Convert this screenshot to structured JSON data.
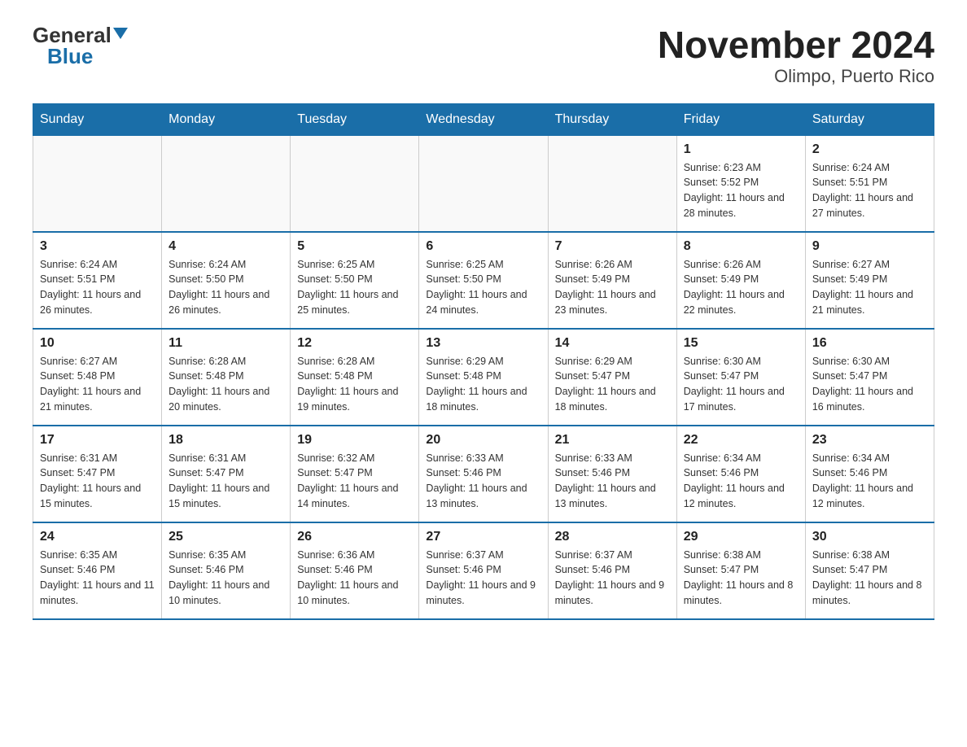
{
  "logo": {
    "general": "General",
    "blue": "Blue"
  },
  "title": "November 2024",
  "subtitle": "Olimpo, Puerto Rico",
  "days_header": [
    "Sunday",
    "Monday",
    "Tuesday",
    "Wednesday",
    "Thursday",
    "Friday",
    "Saturday"
  ],
  "weeks": [
    [
      {
        "day": "",
        "sunrise": "",
        "sunset": "",
        "daylight": ""
      },
      {
        "day": "",
        "sunrise": "",
        "sunset": "",
        "daylight": ""
      },
      {
        "day": "",
        "sunrise": "",
        "sunset": "",
        "daylight": ""
      },
      {
        "day": "",
        "sunrise": "",
        "sunset": "",
        "daylight": ""
      },
      {
        "day": "",
        "sunrise": "",
        "sunset": "",
        "daylight": ""
      },
      {
        "day": "1",
        "sunrise": "Sunrise: 6:23 AM",
        "sunset": "Sunset: 5:52 PM",
        "daylight": "Daylight: 11 hours and 28 minutes."
      },
      {
        "day": "2",
        "sunrise": "Sunrise: 6:24 AM",
        "sunset": "Sunset: 5:51 PM",
        "daylight": "Daylight: 11 hours and 27 minutes."
      }
    ],
    [
      {
        "day": "3",
        "sunrise": "Sunrise: 6:24 AM",
        "sunset": "Sunset: 5:51 PM",
        "daylight": "Daylight: 11 hours and 26 minutes."
      },
      {
        "day": "4",
        "sunrise": "Sunrise: 6:24 AM",
        "sunset": "Sunset: 5:50 PM",
        "daylight": "Daylight: 11 hours and 26 minutes."
      },
      {
        "day": "5",
        "sunrise": "Sunrise: 6:25 AM",
        "sunset": "Sunset: 5:50 PM",
        "daylight": "Daylight: 11 hours and 25 minutes."
      },
      {
        "day": "6",
        "sunrise": "Sunrise: 6:25 AM",
        "sunset": "Sunset: 5:50 PM",
        "daylight": "Daylight: 11 hours and 24 minutes."
      },
      {
        "day": "7",
        "sunrise": "Sunrise: 6:26 AM",
        "sunset": "Sunset: 5:49 PM",
        "daylight": "Daylight: 11 hours and 23 minutes."
      },
      {
        "day": "8",
        "sunrise": "Sunrise: 6:26 AM",
        "sunset": "Sunset: 5:49 PM",
        "daylight": "Daylight: 11 hours and 22 minutes."
      },
      {
        "day": "9",
        "sunrise": "Sunrise: 6:27 AM",
        "sunset": "Sunset: 5:49 PM",
        "daylight": "Daylight: 11 hours and 21 minutes."
      }
    ],
    [
      {
        "day": "10",
        "sunrise": "Sunrise: 6:27 AM",
        "sunset": "Sunset: 5:48 PM",
        "daylight": "Daylight: 11 hours and 21 minutes."
      },
      {
        "day": "11",
        "sunrise": "Sunrise: 6:28 AM",
        "sunset": "Sunset: 5:48 PM",
        "daylight": "Daylight: 11 hours and 20 minutes."
      },
      {
        "day": "12",
        "sunrise": "Sunrise: 6:28 AM",
        "sunset": "Sunset: 5:48 PM",
        "daylight": "Daylight: 11 hours and 19 minutes."
      },
      {
        "day": "13",
        "sunrise": "Sunrise: 6:29 AM",
        "sunset": "Sunset: 5:48 PM",
        "daylight": "Daylight: 11 hours and 18 minutes."
      },
      {
        "day": "14",
        "sunrise": "Sunrise: 6:29 AM",
        "sunset": "Sunset: 5:47 PM",
        "daylight": "Daylight: 11 hours and 18 minutes."
      },
      {
        "day": "15",
        "sunrise": "Sunrise: 6:30 AM",
        "sunset": "Sunset: 5:47 PM",
        "daylight": "Daylight: 11 hours and 17 minutes."
      },
      {
        "day": "16",
        "sunrise": "Sunrise: 6:30 AM",
        "sunset": "Sunset: 5:47 PM",
        "daylight": "Daylight: 11 hours and 16 minutes."
      }
    ],
    [
      {
        "day": "17",
        "sunrise": "Sunrise: 6:31 AM",
        "sunset": "Sunset: 5:47 PM",
        "daylight": "Daylight: 11 hours and 15 minutes."
      },
      {
        "day": "18",
        "sunrise": "Sunrise: 6:31 AM",
        "sunset": "Sunset: 5:47 PM",
        "daylight": "Daylight: 11 hours and 15 minutes."
      },
      {
        "day": "19",
        "sunrise": "Sunrise: 6:32 AM",
        "sunset": "Sunset: 5:47 PM",
        "daylight": "Daylight: 11 hours and 14 minutes."
      },
      {
        "day": "20",
        "sunrise": "Sunrise: 6:33 AM",
        "sunset": "Sunset: 5:46 PM",
        "daylight": "Daylight: 11 hours and 13 minutes."
      },
      {
        "day": "21",
        "sunrise": "Sunrise: 6:33 AM",
        "sunset": "Sunset: 5:46 PM",
        "daylight": "Daylight: 11 hours and 13 minutes."
      },
      {
        "day": "22",
        "sunrise": "Sunrise: 6:34 AM",
        "sunset": "Sunset: 5:46 PM",
        "daylight": "Daylight: 11 hours and 12 minutes."
      },
      {
        "day": "23",
        "sunrise": "Sunrise: 6:34 AM",
        "sunset": "Sunset: 5:46 PM",
        "daylight": "Daylight: 11 hours and 12 minutes."
      }
    ],
    [
      {
        "day": "24",
        "sunrise": "Sunrise: 6:35 AM",
        "sunset": "Sunset: 5:46 PM",
        "daylight": "Daylight: 11 hours and 11 minutes."
      },
      {
        "day": "25",
        "sunrise": "Sunrise: 6:35 AM",
        "sunset": "Sunset: 5:46 PM",
        "daylight": "Daylight: 11 hours and 10 minutes."
      },
      {
        "day": "26",
        "sunrise": "Sunrise: 6:36 AM",
        "sunset": "Sunset: 5:46 PM",
        "daylight": "Daylight: 11 hours and 10 minutes."
      },
      {
        "day": "27",
        "sunrise": "Sunrise: 6:37 AM",
        "sunset": "Sunset: 5:46 PM",
        "daylight": "Daylight: 11 hours and 9 minutes."
      },
      {
        "day": "28",
        "sunrise": "Sunrise: 6:37 AM",
        "sunset": "Sunset: 5:46 PM",
        "daylight": "Daylight: 11 hours and 9 minutes."
      },
      {
        "day": "29",
        "sunrise": "Sunrise: 6:38 AM",
        "sunset": "Sunset: 5:47 PM",
        "daylight": "Daylight: 11 hours and 8 minutes."
      },
      {
        "day": "30",
        "sunrise": "Sunrise: 6:38 AM",
        "sunset": "Sunset: 5:47 PM",
        "daylight": "Daylight: 11 hours and 8 minutes."
      }
    ]
  ]
}
